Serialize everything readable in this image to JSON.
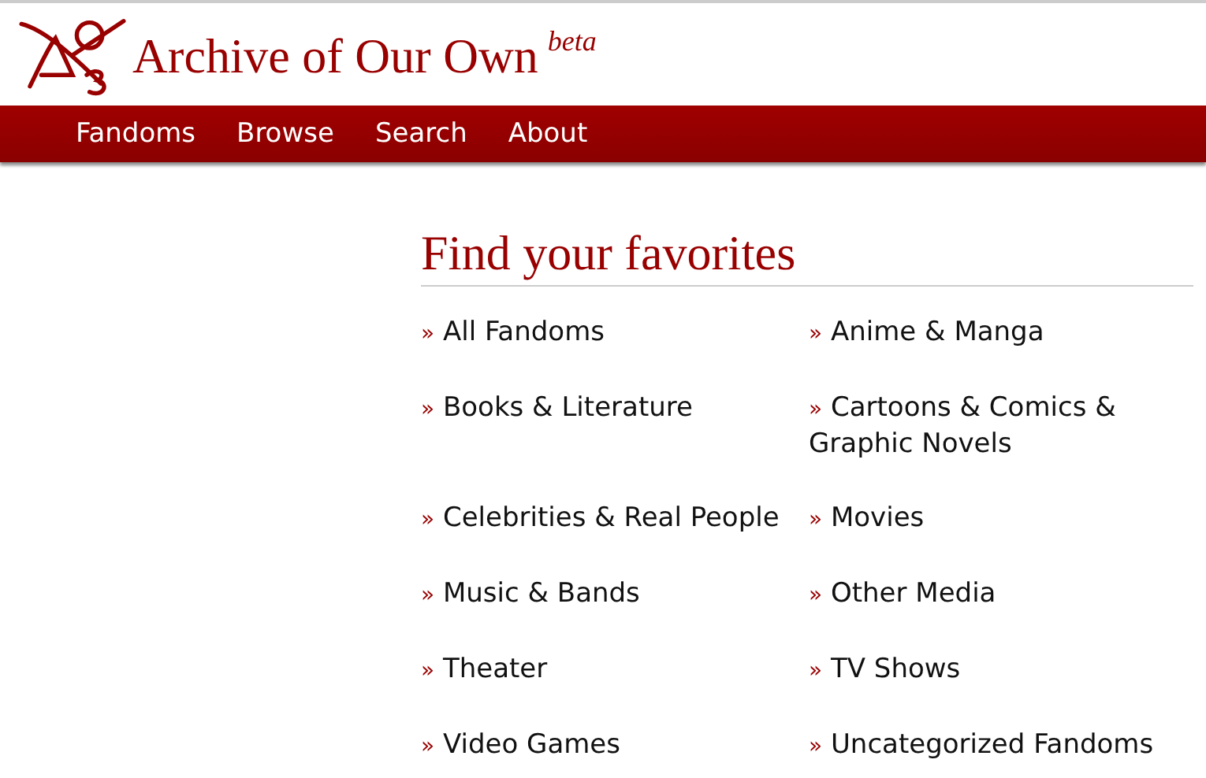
{
  "site": {
    "title": "Archive of Our Own",
    "badge": "beta"
  },
  "nav": [
    {
      "label": "Fandoms"
    },
    {
      "label": "Browse"
    },
    {
      "label": "Search"
    },
    {
      "label": "About"
    }
  ],
  "section": {
    "heading": "Find your favorites",
    "links": [
      {
        "marker": "»",
        "label": "All Fandoms"
      },
      {
        "marker": "»",
        "label": "Anime & Manga"
      },
      {
        "marker": "»",
        "label": "Books & Literature"
      },
      {
        "marker": "»",
        "label": "Cartoons & Comics & Graphic Novels"
      },
      {
        "marker": "»",
        "label": "Celebrities & Real People"
      },
      {
        "marker": "»",
        "label": "Movies"
      },
      {
        "marker": "»",
        "label": "Music & Bands"
      },
      {
        "marker": "»",
        "label": "Other Media"
      },
      {
        "marker": "»",
        "label": "Theater"
      },
      {
        "marker": "»",
        "label": "TV Shows"
      },
      {
        "marker": "»",
        "label": "Video Games"
      },
      {
        "marker": "»",
        "label": "Uncategorized Fandoms"
      }
    ]
  }
}
